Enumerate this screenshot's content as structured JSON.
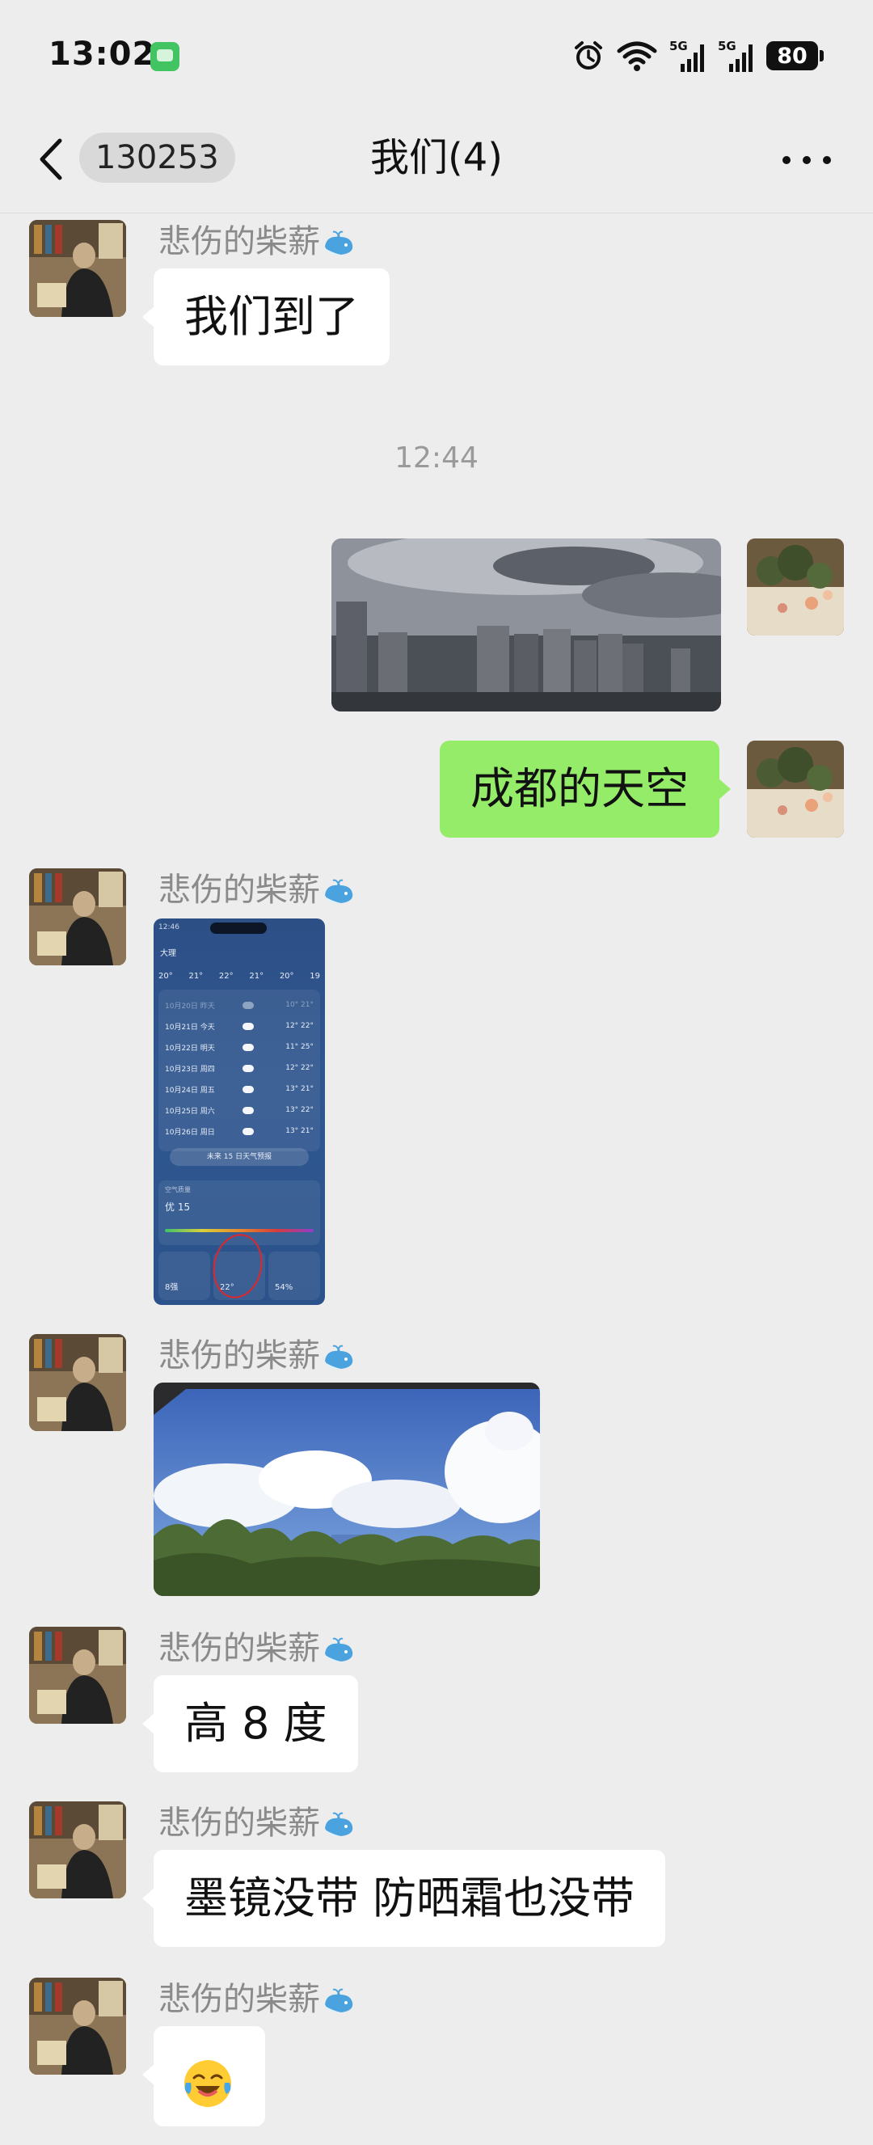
{
  "status_bar": {
    "time": "13:02",
    "network": "5G",
    "battery": "80"
  },
  "header": {
    "back_count": "130253",
    "title": "我们(4)"
  },
  "messages": [
    {
      "side": "left",
      "sender": "悲伤的柴薪",
      "type": "text",
      "text": "我们到了"
    },
    {
      "type": "timestamp",
      "text": "12:44"
    },
    {
      "side": "right",
      "type": "image",
      "image": "cloudy-city-skyline"
    },
    {
      "side": "right",
      "type": "text",
      "text": "成都的天空"
    },
    {
      "side": "left",
      "sender": "悲伤的柴薪",
      "type": "image",
      "image": "weather-app-screenshot"
    },
    {
      "side": "left",
      "sender": "悲伤的柴薪",
      "type": "image",
      "image": "blue-sky-trees"
    },
    {
      "side": "left",
      "sender": "悲伤的柴薪",
      "type": "text",
      "text": "高 8 度"
    },
    {
      "side": "left",
      "sender": "悲伤的柴薪",
      "type": "text",
      "text": "墨镜没带 防晒霜也没带"
    },
    {
      "side": "left",
      "sender": "悲伤的柴薪",
      "type": "emoji",
      "emoji": "crying-laughing-emoji"
    }
  ],
  "weather_shot": {
    "status_time": "12:46",
    "city": "大理",
    "temps": [
      "20°",
      "21°",
      "22°",
      "21°",
      "20°",
      "19"
    ],
    "rows": [
      {
        "day": "10月20日 昨天",
        "temp": "10° 21°"
      },
      {
        "day": "10月21日 今天",
        "temp": "12° 22°"
      },
      {
        "day": "10月22日 明天",
        "temp": "11° 25°"
      },
      {
        "day": "10月23日 周四",
        "temp": "12° 22°"
      },
      {
        "day": "10月24日 周五",
        "temp": "13° 21°"
      },
      {
        "day": "10月25日 周六",
        "temp": "13° 22°"
      },
      {
        "day": "10月26日 周日",
        "temp": "13° 21°"
      }
    ],
    "forecast_button": "未来 15 日天气预报",
    "aqi_label": "空气质量",
    "aqi_value": "优 15",
    "cards": [
      {
        "label": "紫外线",
        "value": "8强"
      },
      {
        "label": "体感温度",
        "value": "22°"
      },
      {
        "label": "湿度",
        "value": "54%"
      }
    ]
  },
  "colors": {
    "background": "#ededed",
    "my_bubble": "#95ec69",
    "their_bubble": "#ffffff",
    "sender_name": "#8a8a8a"
  }
}
